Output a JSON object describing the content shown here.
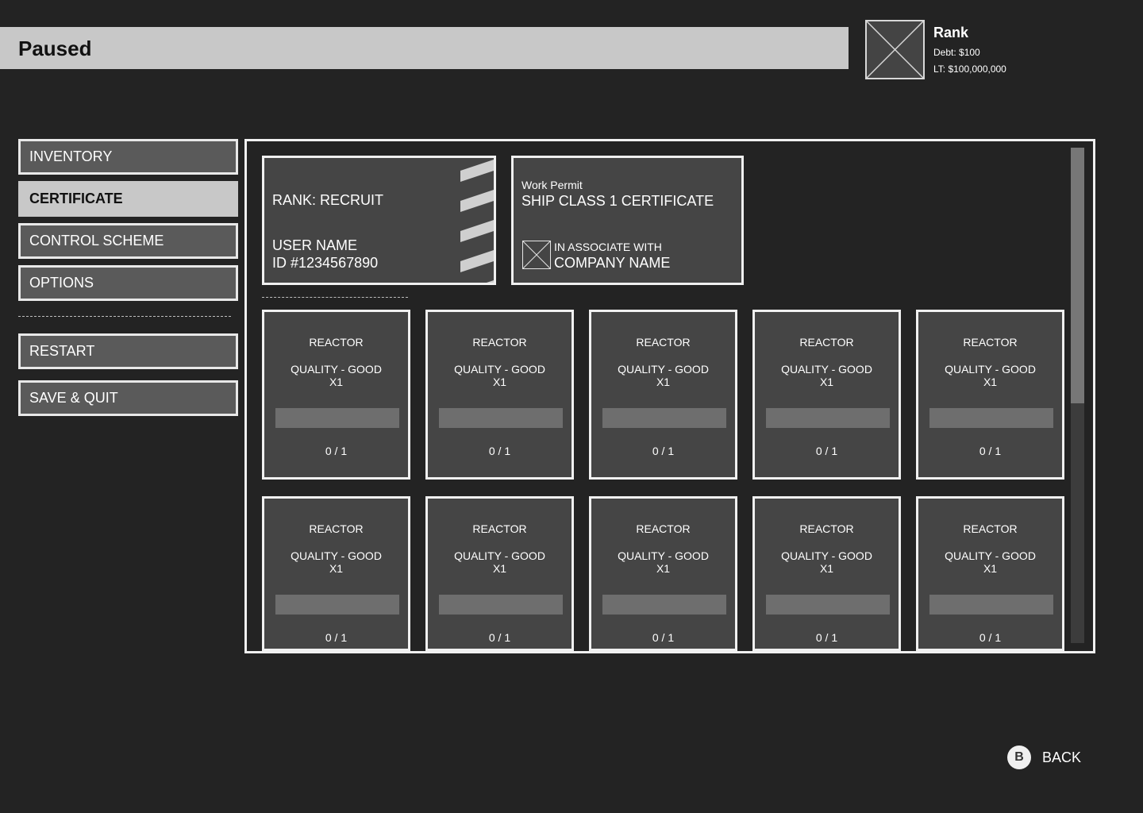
{
  "header": {
    "title": "Paused"
  },
  "rank": {
    "title": "Rank",
    "debt": "Debt: $100",
    "lt": "LT: $100,000,000"
  },
  "menu": {
    "items": [
      {
        "label": "INVENTORY"
      },
      {
        "label": "CERTIFICATE",
        "active": true
      },
      {
        "label": "CONTROL SCHEME"
      },
      {
        "label": "OPTIONS"
      },
      {
        "label": "RESTART"
      },
      {
        "label": "SAVE & QUIT"
      }
    ]
  },
  "certificate": {
    "id_card": {
      "rank": "RANK: RECRUIT",
      "user_name": "USER NAME",
      "user_id": "ID #1234567890"
    },
    "permit": {
      "type": "Work Permit",
      "class": "SHIP CLASS 1 CERTIFICATE",
      "associate": "IN ASSOCIATE WITH",
      "company": "COMPANY NAME"
    },
    "items": [
      {
        "name": "REACTOR",
        "quality": "QUALITY - GOOD",
        "qty": "X1",
        "count": "0 / 1",
        "progress": 0
      },
      {
        "name": "REACTOR",
        "quality": "QUALITY - GOOD",
        "qty": "X1",
        "count": "0 / 1",
        "progress": 0
      },
      {
        "name": "REACTOR",
        "quality": "QUALITY - GOOD",
        "qty": "X1",
        "count": "0 / 1",
        "progress": 0
      },
      {
        "name": "REACTOR",
        "quality": "QUALITY - GOOD",
        "qty": "X1",
        "count": "0 / 1",
        "progress": 0
      },
      {
        "name": "REACTOR",
        "quality": "QUALITY - GOOD",
        "qty": "X1",
        "count": "0 / 1",
        "progress": 0
      },
      {
        "name": "REACTOR",
        "quality": "QUALITY - GOOD",
        "qty": "X1",
        "count": "0 / 1",
        "progress": 0
      },
      {
        "name": "REACTOR",
        "quality": "QUALITY - GOOD",
        "qty": "X1",
        "count": "0 / 1",
        "progress": 0
      },
      {
        "name": "REACTOR",
        "quality": "QUALITY - GOOD",
        "qty": "X1",
        "count": "0 / 1",
        "progress": 0
      },
      {
        "name": "REACTOR",
        "quality": "QUALITY - GOOD",
        "qty": "X1",
        "count": "0 / 1",
        "progress": 0
      },
      {
        "name": "REACTOR",
        "quality": "QUALITY - GOOD",
        "qty": "X1",
        "count": "0 / 1",
        "progress": 0
      }
    ]
  },
  "footer": {
    "back_key": "B",
    "back_label": "BACK"
  },
  "icons": {
    "avatar": "image-placeholder-icon",
    "company_logo": "image-placeholder-icon",
    "back": "b-button-icon"
  },
  "colors": {
    "background": "#232323",
    "title_bar": "#c8c8c8",
    "card": "#454545",
    "border": "#f0f0f0"
  }
}
